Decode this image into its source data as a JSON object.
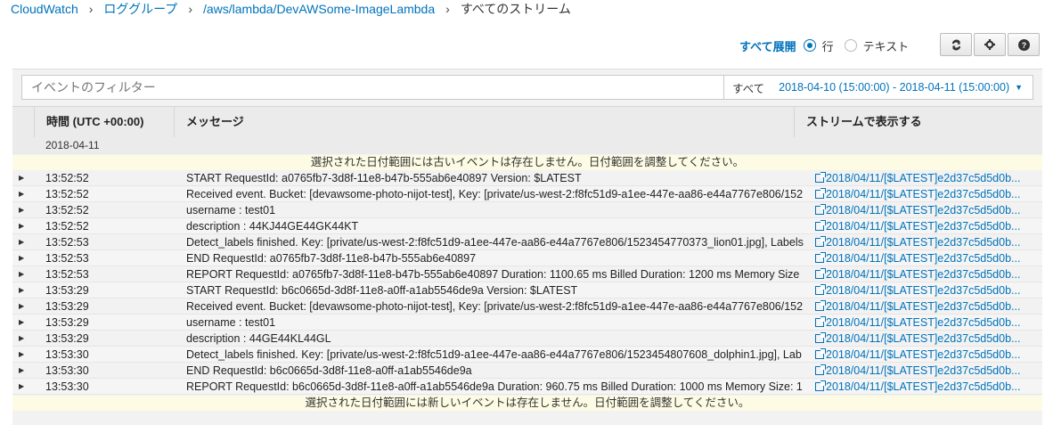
{
  "breadcrumb": {
    "items": [
      "CloudWatch",
      "ロググループ",
      "/aws/lambda/DevAWSome-ImageLambda"
    ],
    "current": "すべてのストリーム"
  },
  "toolbar": {
    "expand_all": "すべて展開",
    "view_row": "行",
    "view_text": "テキスト",
    "selected_view": "行"
  },
  "filter": {
    "placeholder": "イベントのフィルター",
    "scope": "すべて",
    "date_range": "2018-04-10 (15:00:00) - 2018-04-11 (15:00:00)"
  },
  "table": {
    "headers": [
      "時間 (UTC +00:00)",
      "メッセージ",
      "ストリームで表示する"
    ],
    "date_group": "2018-04-11",
    "notice_top": "選択された日付範囲には古いイベントは存在しません。日付範囲を調整してください。",
    "notice_bottom": "選択された日付範囲には新しいイベントは存在しません。日付範囲を調整してください。",
    "rows": [
      {
        "time": "13:52:52",
        "message": "START RequestId: a0765fb7-3d8f-11e8-b47b-555ab6e40897 Version: $LATEST",
        "stream": "2018/04/11/[$LATEST]e2d37c5d5d0b..."
      },
      {
        "time": "13:52:52",
        "message": "Received event. Bucket: [devawsome-photo-nijot-test], Key: [private/us-west-2:f8fc51d9-a1ee-447e-aa86-e44a7767e806/152",
        "stream": "2018/04/11/[$LATEST]e2d37c5d5d0b..."
      },
      {
        "time": "13:52:52",
        "message": "username : test01",
        "stream": "2018/04/11/[$LATEST]e2d37c5d5d0b..."
      },
      {
        "time": "13:52:52",
        "message": "description : 44KJ44GE44GK44KT",
        "stream": "2018/04/11/[$LATEST]e2d37c5d5d0b..."
      },
      {
        "time": "13:52:53",
        "message": "Detect_labels finished. Key: [private/us-west-2:f8fc51d9-a1ee-447e-aa86-e44a7767e806/1523454770373_lion01.jpg], Labels",
        "stream": "2018/04/11/[$LATEST]e2d37c5d5d0b..."
      },
      {
        "time": "13:52:53",
        "message": "END RequestId: a0765fb7-3d8f-11e8-b47b-555ab6e40897",
        "stream": "2018/04/11/[$LATEST]e2d37c5d5d0b..."
      },
      {
        "time": "13:52:53",
        "message": "REPORT RequestId: a0765fb7-3d8f-11e8-b47b-555ab6e40897 Duration: 1100.65 ms Billed Duration: 1200 ms Memory Size",
        "stream": "2018/04/11/[$LATEST]e2d37c5d5d0b..."
      },
      {
        "time": "13:53:29",
        "message": "START RequestId: b6c0665d-3d8f-11e8-a0ff-a1ab5546de9a Version: $LATEST",
        "stream": "2018/04/11/[$LATEST]e2d37c5d5d0b..."
      },
      {
        "time": "13:53:29",
        "message": "Received event. Bucket: [devawsome-photo-nijot-test], Key: [private/us-west-2:f8fc51d9-a1ee-447e-aa86-e44a7767e806/152",
        "stream": "2018/04/11/[$LATEST]e2d37c5d5d0b..."
      },
      {
        "time": "13:53:29",
        "message": "username : test01",
        "stream": "2018/04/11/[$LATEST]e2d37c5d5d0b..."
      },
      {
        "time": "13:53:29",
        "message": "description : 44GE44KL44GL",
        "stream": "2018/04/11/[$LATEST]e2d37c5d5d0b..."
      },
      {
        "time": "13:53:30",
        "message": "Detect_labels finished. Key: [private/us-west-2:f8fc51d9-a1ee-447e-aa86-e44a7767e806/1523454807608_dolphin1.jpg], Lab",
        "stream": "2018/04/11/[$LATEST]e2d37c5d5d0b..."
      },
      {
        "time": "13:53:30",
        "message": "END RequestId: b6c0665d-3d8f-11e8-a0ff-a1ab5546de9a",
        "stream": "2018/04/11/[$LATEST]e2d37c5d5d0b..."
      },
      {
        "time": "13:53:30",
        "message": "REPORT RequestId: b6c0665d-3d8f-11e8-a0ff-a1ab5546de9a Duration: 960.75 ms Billed Duration: 1000 ms Memory Size: 1",
        "stream": "2018/04/11/[$LATEST]e2d37c5d5d0b..."
      }
    ]
  },
  "colors": {
    "link": "#0073bb",
    "notice_bg": "#fdfbe4",
    "header_bg": "#ebebeb"
  },
  "icons": [
    "refresh-icon",
    "gear-icon",
    "help-icon",
    "external-link-icon",
    "expand-arrow-icon"
  ]
}
